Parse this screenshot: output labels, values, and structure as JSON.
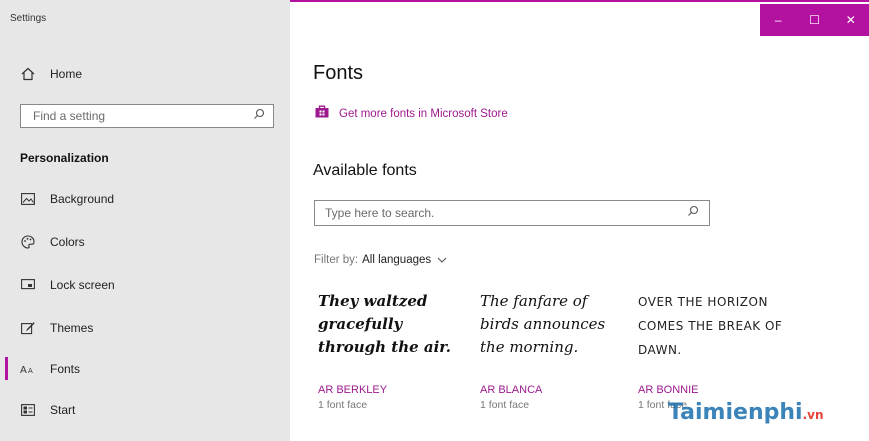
{
  "window": {
    "title": "Settings"
  },
  "titlebar": {
    "minimize": "–",
    "maximize": "☐",
    "close": "✕"
  },
  "sidebar": {
    "home": "Home",
    "search_placeholder": "Find a setting",
    "section": "Personalization",
    "items": [
      {
        "label": "Background",
        "icon": "image-icon"
      },
      {
        "label": "Colors",
        "icon": "palette-icon"
      },
      {
        "label": "Lock screen",
        "icon": "lock-screen-icon"
      },
      {
        "label": "Themes",
        "icon": "brush-icon"
      },
      {
        "label": "Fonts",
        "icon": "font-icon",
        "active": true
      },
      {
        "label": "Start",
        "icon": "start-icon"
      }
    ]
  },
  "main": {
    "title": "Fonts",
    "store_link": "Get more fonts in Microsoft Store",
    "available_heading": "Available fonts",
    "search_placeholder": "Type here to search.",
    "filter_label": "Filter by:",
    "filter_value": "All languages",
    "fonts": [
      {
        "sample": "They waltzed gracefully through the air.",
        "name": "AR BERKLEY",
        "faces": "1 font face"
      },
      {
        "sample": "The fanfare of birds announces the morning.",
        "name": "AR BLANCA",
        "faces": "1 font face"
      },
      {
        "sample": "OVER THE HORIZON COMES THE BREAK OF DAWN.",
        "name": "AR BONNIE",
        "faces": "1 font face"
      }
    ]
  },
  "watermark": {
    "text": "Taimienphi",
    "suffix": ".vn"
  },
  "colors": {
    "accent": "#b3119f",
    "link": "#9c1a8e",
    "sidebar_bg": "#e7e7e7"
  }
}
